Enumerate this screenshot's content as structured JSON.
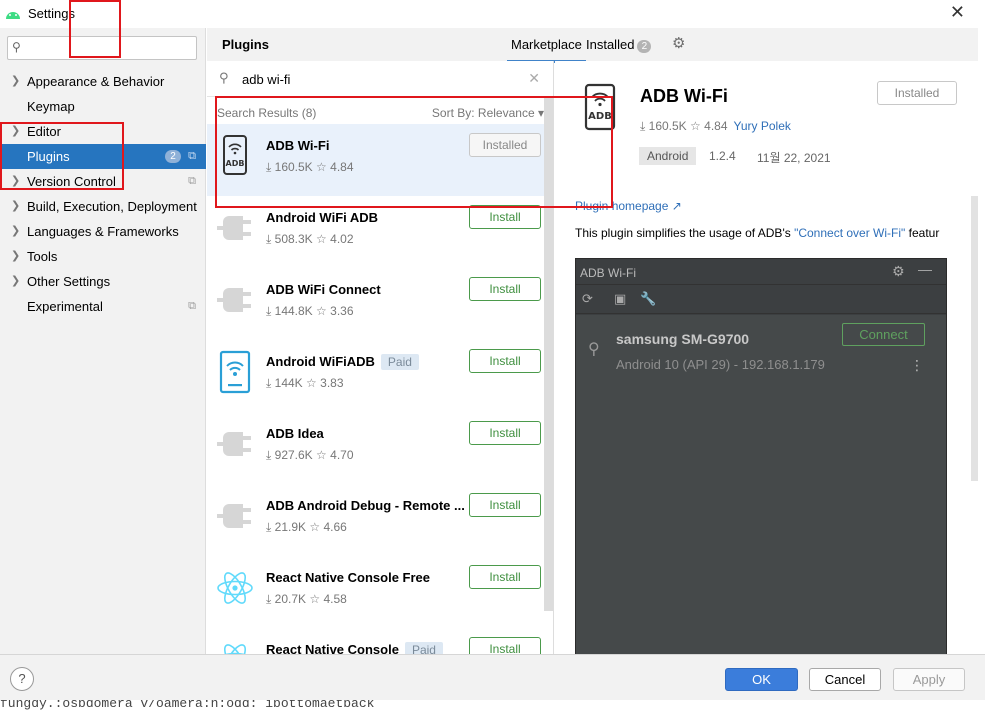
{
  "window": {
    "title": "Settings",
    "close_glyph": "✕"
  },
  "sidebar": {
    "search_placeholder": "",
    "items": [
      {
        "label": "Appearance & Behavior",
        "expandable": true
      },
      {
        "label": "Keymap",
        "expandable": false
      },
      {
        "label": "Editor",
        "expandable": true
      },
      {
        "label": "Plugins",
        "expandable": false,
        "badge": "2",
        "selected": true
      },
      {
        "label": "Version Control",
        "expandable": true
      },
      {
        "label": "Build, Execution, Deployment",
        "expandable": true
      },
      {
        "label": "Languages & Frameworks",
        "expandable": true
      },
      {
        "label": "Tools",
        "expandable": true
      },
      {
        "label": "Other Settings",
        "expandable": true
      },
      {
        "label": "Experimental",
        "expandable": false
      }
    ]
  },
  "plugins": {
    "title": "Plugins",
    "tabs": {
      "marketplace": "Marketplace",
      "installed": "Installed",
      "installed_count": "2"
    },
    "search_query": "adb wi-fi",
    "results_count": "Search Results (8)",
    "sort_by": "Sort By: Relevance",
    "list": [
      {
        "name": "ADB Wi-Fi",
        "downloads": "160.5K",
        "rating": "4.84",
        "button": "Installed",
        "icon": "adb-wifi-icon",
        "selected": true
      },
      {
        "name": "Android WiFi ADB",
        "downloads": "508.3K",
        "rating": "4.02",
        "button": "Install",
        "icon": "plug-icon"
      },
      {
        "name": "ADB WiFi Connect",
        "downloads": "144.8K",
        "rating": "3.36",
        "button": "Install",
        "icon": "plug-icon"
      },
      {
        "name": "Android WiFiADB",
        "downloads": "144K",
        "rating": "3.83",
        "button": "Install",
        "icon": "phone-wifi-icon",
        "paid": "Paid"
      },
      {
        "name": "ADB Idea",
        "downloads": "927.6K",
        "rating": "4.70",
        "button": "Install",
        "icon": "plug-icon"
      },
      {
        "name": "ADB Android Debug - Remote ...",
        "downloads": "21.9K",
        "rating": "4.66",
        "button": "Install",
        "icon": "plug-icon"
      },
      {
        "name": "React Native Console Free",
        "downloads": "20.7K",
        "rating": "4.58",
        "button": "Install",
        "icon": "react-icon"
      },
      {
        "name": "React Native Console",
        "downloads": "",
        "rating": "",
        "button": "Install",
        "icon": "react-icon",
        "paid": "Paid"
      }
    ]
  },
  "detail": {
    "name": "ADB Wi-Fi",
    "button": "Installed",
    "downloads": "160.5K",
    "rating": "4.84",
    "author": "Yury Polek",
    "tag": "Android",
    "version": "1.2.4",
    "date": "11월 22, 2021",
    "homepage": "Plugin homepage ↗",
    "desc_prefix": "This plugin simplifies the usage of ADB's ",
    "desc_link": "\"Connect over Wi-Fi\"",
    "desc_suffix": " featur",
    "screenshot": {
      "title": "ADB Wi-Fi",
      "device": "samsung SM-G9700",
      "sub": "Android 10 (API 29) - 192.168.1.179",
      "connect": "Connect"
    }
  },
  "footer": {
    "help": "?",
    "ok": "OK",
    "cancel": "Cancel",
    "apply": "Apply"
  },
  "console_text": "fungdy.:osbdomera v/oamera:n:odd: ibottomaetback"
}
